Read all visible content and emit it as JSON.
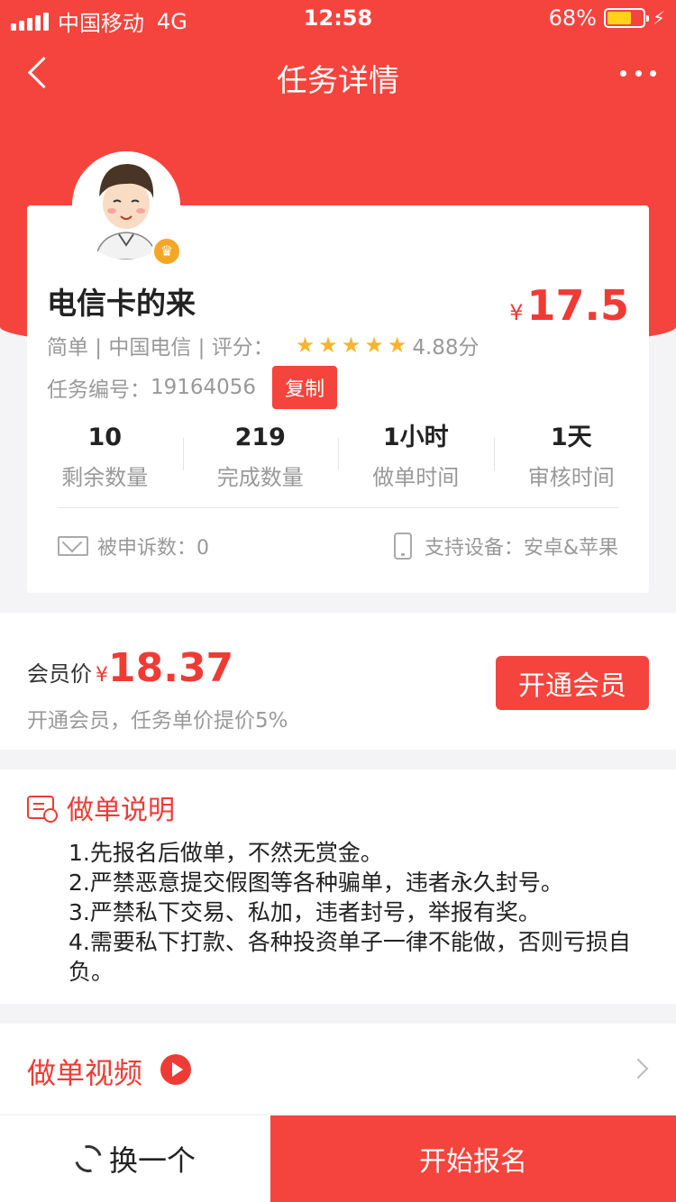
{
  "status_bar": {
    "carrier": "中国移动",
    "network": "4G",
    "time": "12:58",
    "battery": "68%",
    "battery_level": 0.68
  },
  "nav": {
    "title": "任务详情"
  },
  "task": {
    "title": "电信卡的来",
    "price_symbol": "¥",
    "price": "17.5",
    "meta": "简单 | 中国电信 | 评分：",
    "stars": 5,
    "rating": "4.88分",
    "id_label": "任务编号：",
    "id": "19164056",
    "copy_label": "复制",
    "stats": [
      {
        "value": "10",
        "label": "剩余数量"
      },
      {
        "value": "219",
        "label": "完成数量"
      },
      {
        "value": "1小时",
        "label": "做单时间"
      },
      {
        "value": "1天",
        "label": "审核时间"
      }
    ],
    "complaints": "被申诉数：0",
    "devices": "支持设备：安卓&苹果"
  },
  "member": {
    "label": "会员价",
    "symbol": "¥",
    "price": "18.37",
    "desc": "开通会员，任务单价提价5%",
    "button": "开通会员"
  },
  "instructions": {
    "title": "做单说明",
    "items": [
      "1.先报名后做单，不然无赏金。",
      "2.严禁恶意提交假图等各种骗单，违者永久封号。",
      "3.严禁私下交易、私加，违者封号，举报有奖。",
      "4.需要私下打款、各种投资单子一律不能做，否则亏损自负。"
    ]
  },
  "video": {
    "label": "做单视频"
  },
  "bottom": {
    "switch_label": "换一个",
    "signup_label": "开始报名"
  },
  "colors": {
    "primary": "#f5443d",
    "price": "#ef3b35",
    "star": "#f7b52c",
    "battery": "#ffd21a",
    "badge": "#f5a623"
  }
}
